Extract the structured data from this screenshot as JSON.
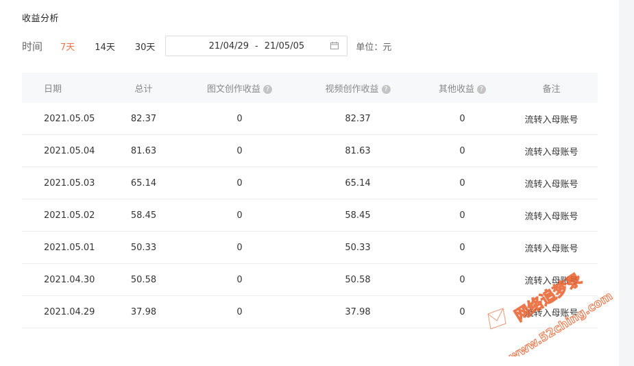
{
  "page": {
    "title": "收益分析"
  },
  "filter": {
    "time_label": "时间",
    "ranges": [
      {
        "label": "7天",
        "active": true
      },
      {
        "label": "14天",
        "active": false
      },
      {
        "label": "30天",
        "active": false
      }
    ],
    "date_start": "21/04/29",
    "date_sep": "-",
    "date_end": "21/05/05",
    "unit_label": "单位：元"
  },
  "table": {
    "columns": [
      {
        "label": "日期",
        "help": false
      },
      {
        "label": "总计",
        "help": false
      },
      {
        "label": "图文创作收益",
        "help": true
      },
      {
        "label": "视频创作收益",
        "help": true
      },
      {
        "label": "其他收益",
        "help": true
      },
      {
        "label": "备注",
        "help": false
      }
    ],
    "help_glyph": "?",
    "rows": [
      [
        "2021.05.05",
        "82.37",
        "0",
        "82.37",
        "0",
        "流转入母账号"
      ],
      [
        "2021.05.04",
        "81.63",
        "0",
        "81.63",
        "0",
        "流转入母账号"
      ],
      [
        "2021.05.03",
        "65.14",
        "0",
        "65.14",
        "0",
        "流转入母账号"
      ],
      [
        "2021.05.02",
        "58.45",
        "0",
        "58.45",
        "0",
        "流转入母账号"
      ],
      [
        "2021.05.01",
        "50.33",
        "0",
        "50.33",
        "0",
        "流转入母账号"
      ],
      [
        "2021.04.30",
        "50.58",
        "0",
        "50.58",
        "0",
        "流转入母账号"
      ],
      [
        "2021.04.29",
        "37.98",
        "0",
        "37.98",
        "0",
        "流转入母账号"
      ]
    ]
  },
  "watermark": {
    "line1": "网络追梦录",
    "line2": "www.52ching.com"
  },
  "colors": {
    "accent": "#f0734a",
    "watermark": "#e8602c"
  }
}
